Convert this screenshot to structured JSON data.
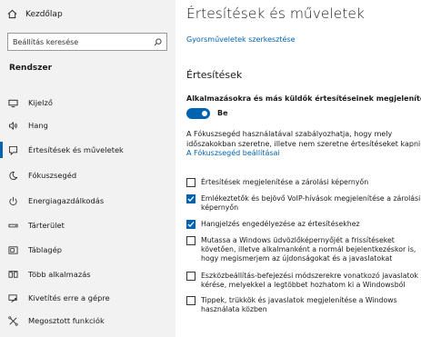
{
  "sidebar": {
    "home_label": "Kezdőlap",
    "search_placeholder": "Beállítás keresése",
    "section_title": "Rendszer",
    "items": [
      {
        "label": "Kijelző",
        "icon": "display-icon"
      },
      {
        "label": "Hang",
        "icon": "speaker-icon"
      },
      {
        "label": "Értesítések és műveletek",
        "icon": "notification-icon",
        "selected": true
      },
      {
        "label": "Fókuszsegéd",
        "icon": "moon-icon"
      },
      {
        "label": "Energiagazdálkodás",
        "icon": "power-icon"
      },
      {
        "label": "Tárterület",
        "icon": "storage-icon"
      },
      {
        "label": "Táblagép",
        "icon": "tablet-icon"
      },
      {
        "label": "Több alkalmazás",
        "icon": "multitasking-icon"
      },
      {
        "label": "Kivetítés erre a gépre",
        "icon": "projecting-icon"
      },
      {
        "label": "Megosztott funkciók",
        "icon": "shared-icon"
      }
    ]
  },
  "main": {
    "title": "Értesítések és műveletek",
    "quick_actions_link": "Gyorsműveletek szerkesztése",
    "notifications_heading": "Értesítések",
    "toggle_label": "Alkalmazásokra és más küldők értesítéseinek megjelenítése",
    "toggle_state": "Be",
    "toggle_on": true,
    "focus_desc_lines": [
      "A Fókuszsegéd használatával szabályozhatja, hogy mely",
      "időszakokban szeretne, illetve nem szeretne értesítéseket kapni."
    ],
    "focus_link": "A Fókuszsegéd beállításai",
    "checkboxes": [
      {
        "checked": false,
        "lines": [
          "Értesítések megjelenítése a zárolási képernyőn"
        ]
      },
      {
        "checked": true,
        "lines": [
          "Emlékeztetők és bejövő VoIP-hívások megjelenítése a zárolási",
          "képernyőn"
        ]
      },
      {
        "checked": true,
        "lines": [
          "Hangjelzés engedélyezése az értesítésekhez"
        ]
      },
      {
        "checked": false,
        "lines": [
          "Mutassa a Windows üdvözlőképernyőjét a frissítéseket",
          "követően, illetve alkalmanként a normál bejelentkezéskor is,",
          "hogy megismerjem az újdonságokat és a javaslatokat"
        ]
      },
      {
        "checked": false,
        "lines": [
          "Eszközbeállítás-befejezési módszerekre vonatkozó javaslatok",
          "kérése, melyekkel a legtöbbet hozhatom ki a Windowsból"
        ]
      },
      {
        "checked": false,
        "lines": [
          "Tippek, trükkök és javaslatok megjelenítése a Windows",
          "használata közben"
        ]
      }
    ]
  },
  "colors": {
    "accent": "#0063b1",
    "sidebar_bg": "#f2f2f2"
  }
}
